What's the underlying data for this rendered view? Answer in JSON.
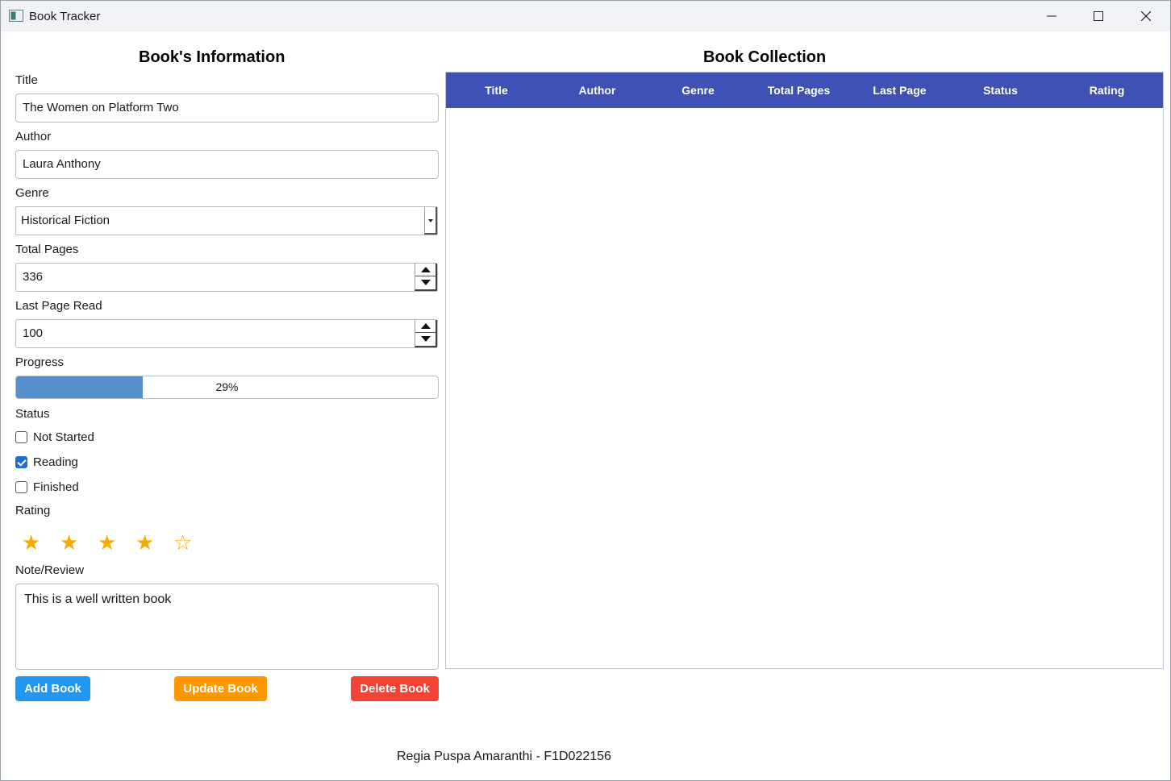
{
  "window": {
    "title": "Book Tracker"
  },
  "form": {
    "heading": "Book's Information",
    "title_label": "Title",
    "title_value": "The Women on Platform Two",
    "author_label": "Author",
    "author_value": "Laura Anthony",
    "genre_label": "Genre",
    "genre_value": "Historical Fiction",
    "total_pages_label": "Total Pages",
    "total_pages_value": "336",
    "last_page_label": "Last Page Read",
    "last_page_value": "100",
    "progress_label": "Progress",
    "progress_text": "29%",
    "progress_fraction": 0.3,
    "status_label": "Status",
    "status_options": [
      {
        "label": "Not Started",
        "checked": false
      },
      {
        "label": "Reading",
        "checked": true
      },
      {
        "label": "Finished",
        "checked": false
      }
    ],
    "rating_label": "Rating",
    "rating_value": 4,
    "rating_max": 5,
    "note_label": "Note/Review",
    "note_value": "This is a well written book"
  },
  "buttons": {
    "add": "Add Book",
    "update": "Update Book",
    "delete": "Delete Book"
  },
  "collection": {
    "heading": "Book Collection",
    "columns": [
      "Title",
      "Author",
      "Genre",
      "Total Pages",
      "Last Page",
      "Status",
      "Rating"
    ],
    "rows": []
  },
  "footer": {
    "text": "Regia Puspa Amaranthi - F1D022156"
  },
  "colors": {
    "header_blue": "#3f51b5",
    "add_blue": "#2196f3",
    "update_orange": "#ff9800",
    "delete_red": "#f44336",
    "star": "#f5ac00",
    "progress": "#5590cc"
  }
}
